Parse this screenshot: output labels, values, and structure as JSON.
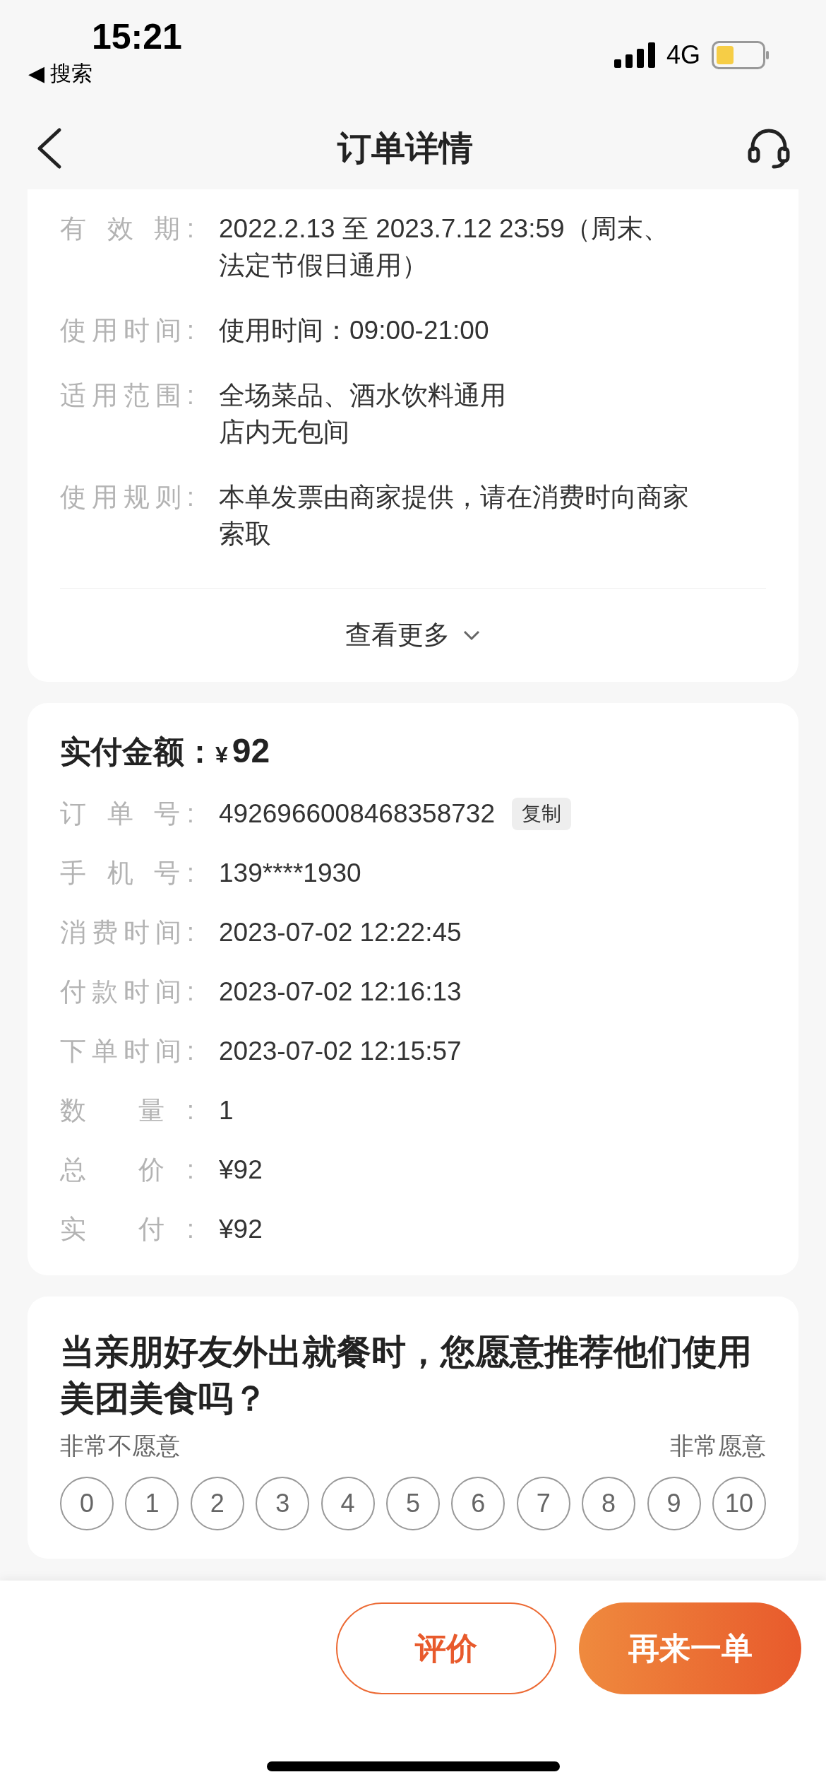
{
  "status_bar": {
    "time": "15:21",
    "back_app": "◀ 搜索",
    "network": "4G"
  },
  "nav": {
    "title": "订单详情"
  },
  "usage_card": {
    "rows": [
      {
        "label": "有 效 期:",
        "lines": [
          "2022.2.13 至 2023.7.12 23:59（周末、",
          "法定节假日通用）"
        ]
      },
      {
        "label": "使用时间:",
        "lines": [
          "使用时间：09:00-21:00"
        ]
      },
      {
        "label": "适用范围:",
        "lines": [
          "全场菜品、酒水饮料通用",
          "店内无包间"
        ]
      },
      {
        "label": "使用规则:",
        "lines": [
          "本单发票由商家提供，请在消费时向商家",
          "索取"
        ]
      }
    ],
    "more": "查看更多"
  },
  "payment_card": {
    "title": "实付金额：",
    "currency": "¥",
    "amount": "92",
    "rows": [
      {
        "label": "订 单 号:",
        "value": "4926966008468358732",
        "action": "复制"
      },
      {
        "label": "手 机 号:",
        "value": "139****1930"
      },
      {
        "label": "消费时间:",
        "value": "2023-07-02 12:22:45"
      },
      {
        "label": "付款时间:",
        "value": "2023-07-02 12:16:13"
      },
      {
        "label": "下单时间:",
        "value": "2023-07-02 12:15:57"
      },
      {
        "label": "数 量:",
        "value": "1"
      },
      {
        "label": "总 价:",
        "value": "¥92"
      },
      {
        "label": "实 付:",
        "value": "¥92"
      }
    ]
  },
  "survey": {
    "question": "当亲朋好友外出就餐时，您愿意推荐他们使用美团美食吗？",
    "low_label": "非常不愿意",
    "high_label": "非常愿意",
    "options": [
      {
        "label": "0",
        "selected": false
      },
      {
        "label": "1",
        "selected": false
      },
      {
        "label": "2",
        "selected": false
      },
      {
        "label": "3",
        "selected": false
      },
      {
        "label": "4",
        "selected": false
      },
      {
        "label": "5",
        "selected": false
      },
      {
        "label": "6",
        "selected": false
      },
      {
        "label": "7",
        "selected": false
      },
      {
        "label": "8",
        "selected": false
      },
      {
        "label": "9",
        "selected": false
      },
      {
        "label": "10",
        "selected": false
      }
    ]
  },
  "actions": [
    {
      "label": "评价",
      "kind": "outline"
    },
    {
      "label": "再来一单",
      "kind": "primary"
    }
  ]
}
